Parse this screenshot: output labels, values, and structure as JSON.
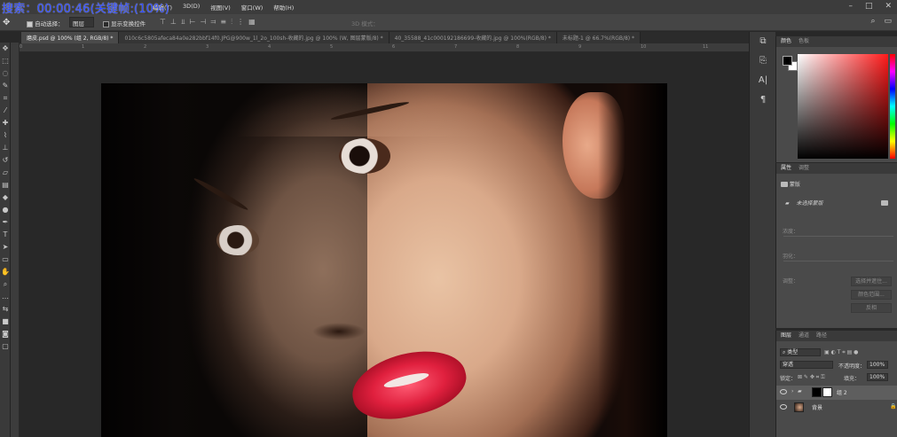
{
  "overlay": {
    "title": "搜索：00:00:46(关键帧:(10%)"
  },
  "menu": {
    "items": [
      "编辑(T)",
      "3D(D)",
      "视图(V)",
      "窗口(W)",
      "帮助(H)"
    ]
  },
  "options": {
    "auto_select_label": "自动选择：",
    "auto_select_value": "图层",
    "show_transform_label": "显示变换控件",
    "mode_3d_label": "3D 模式："
  },
  "tabs": [
    {
      "label": "磨皮.psd @ 100% (组 2, RGB/8) *",
      "active": true
    },
    {
      "label": "010c6c5805afeca84a0e282bbf14f0.JPG@900w_1l_2o_100sh-收藏的.jpg @ 100% (W, 图层蒙版/8) *",
      "active": false
    },
    {
      "label": "40_35588_41c000192186699-收藏的.jpg @ 100%(RGB/8) *",
      "active": false
    },
    {
      "label": "未标题-1 @ 66.7%(RGB/8) *",
      "active": false
    }
  ],
  "ruler": {
    "ticks": [
      "0",
      "1",
      "2",
      "3",
      "4",
      "5",
      "6",
      "7",
      "8",
      "9",
      "10",
      "11"
    ]
  },
  "color_panel": {
    "tabs": [
      "颜色",
      "色板"
    ]
  },
  "properties_panel": {
    "tabs": [
      "属性",
      "调整"
    ],
    "mask_label": "蒙版",
    "no_selection": "未选择蒙版",
    "density_label": "浓度：",
    "feather_label": "羽化：",
    "refine_label": "调整：",
    "btn_select_mask": "选择并遮住...",
    "btn_color_range": "颜色范围...",
    "btn_invert": "反相"
  },
  "layers_panel": {
    "tabs": [
      "图层",
      "通道",
      "路径"
    ],
    "filter_kind": "类型",
    "blend_mode": "穿透",
    "opacity_label": "不透明度：",
    "opacity_value": "100%",
    "lock_label": "锁定：",
    "fill_label": "填充：",
    "fill_value": "100%",
    "layers": [
      {
        "name": "组 2",
        "selected": true
      },
      {
        "name": "背景",
        "selected": false
      }
    ]
  }
}
